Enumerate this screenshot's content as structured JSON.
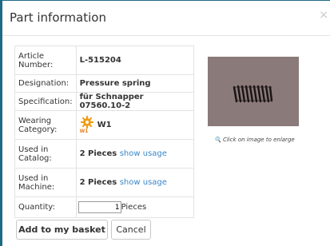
{
  "dialog": {
    "title": "Part information",
    "close_symbol": "×"
  },
  "rows": {
    "article_number": {
      "label": "Article Number:",
      "value": "L-515204"
    },
    "designation": {
      "label": "Designation:",
      "value": "Pressure spring"
    },
    "specification": {
      "label": "Specification:",
      "value": "für Schnapper 07560.10-2"
    },
    "wearing_category": {
      "label": "Wearing Category:",
      "value": "W1",
      "icon": "gear-icon",
      "icon_color": "#f39c12"
    },
    "used_in_catalog": {
      "label": "Used in Catalog:",
      "value": "2 Pieces",
      "link": "show usage"
    },
    "used_in_machine": {
      "label": "Used in Machine:",
      "value": "2 Pieces",
      "link": "show usage"
    },
    "quantity": {
      "label": "Quantity:",
      "value": "1",
      "unit": "Pieces"
    }
  },
  "image": {
    "caption": "Click on image to enlarge",
    "caption_icon": "magnifier-icon",
    "subject": "pressure spring photo"
  },
  "buttons": {
    "add_to_basket": "Add to my basket",
    "cancel": "Cancel"
  },
  "colors": {
    "backdrop": "#1f6a86",
    "link": "#3a87c8",
    "photo_background": "#8b7a7a"
  }
}
